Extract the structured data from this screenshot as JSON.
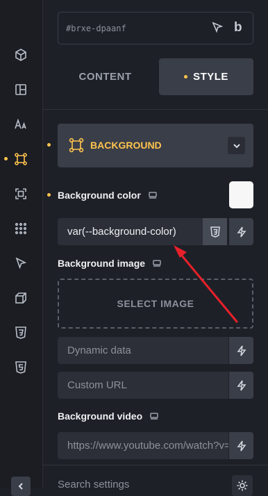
{
  "element_id": {
    "value": "#brxe-dpaanf"
  },
  "tabs": [
    {
      "label": "CONTENT",
      "active": false
    },
    {
      "label": "STYLE",
      "active": true
    }
  ],
  "section": {
    "title": "BACKGROUND"
  },
  "background_color": {
    "label": "Background color",
    "value": "var(--background-color)",
    "swatch_color": "#f7f7f7"
  },
  "background_image": {
    "label": "Background image",
    "select_label": "SELECT IMAGE",
    "dynamic_placeholder": "Dynamic data",
    "url_placeholder": "Custom URL"
  },
  "background_video": {
    "label": "Background video",
    "placeholder": "https://www.youtube.com/watch?v=..."
  },
  "search": {
    "label": "Search settings"
  },
  "colors": {
    "accent": "#ffc44d",
    "annotation_arrow": "#e8202a"
  }
}
